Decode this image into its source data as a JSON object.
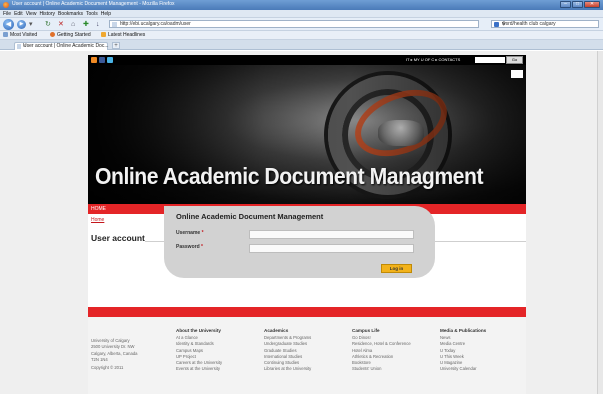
{
  "browser": {
    "window_title": "User account | Online Academic Document Management - Mozilla Firefox",
    "menu": [
      "File",
      "Edit",
      "View",
      "History",
      "Bookmarks",
      "Tools",
      "Help"
    ],
    "url": "http://ebi.ucalgary.ca/oadm/user",
    "search_value": "wsrd/health club calgary",
    "bookmarks": [
      "Most Visited",
      "Getting Started",
      "Latest Headlines"
    ],
    "tab_title": "User account | Online Academic Doc...",
    "new_tab_label": "+",
    "tab_close": "×"
  },
  "site": {
    "top_links": "IT ▸  MY U OF C ▸  CONTACTS",
    "go_label": "Go",
    "banner_title": "Online Academic Document Managment",
    "nav_home": "HOME",
    "breadcrumb": "Home",
    "page_title": "User account"
  },
  "login": {
    "heading": "Online Academic Document Management",
    "username_label": "Username",
    "password_label": "Password",
    "required_mark": "*",
    "submit_label": "Log in"
  },
  "footer": {
    "address": [
      "University of Calgary",
      "2500 University Dr. NW",
      "Calgary, Alberta, Canada",
      "T2N 1N4"
    ],
    "copyright": "Copyright © 2011",
    "columns": [
      {
        "title": "About the University",
        "items": [
          "At a Glance",
          "Identity & Standards",
          "Campus Maps",
          "UP Project",
          "Careers at the University",
          "Events at the University"
        ]
      },
      {
        "title": "Academics",
        "items": [
          "Departments & Programs",
          "Undergraduate Studies",
          "Graduate Studies",
          "International Studies",
          "Continuing Studies",
          "Libraries at the University"
        ]
      },
      {
        "title": "Campus Life",
        "items": [
          "Go Dinos!",
          "Residence, Hotel & Conference",
          "Hotel Alma",
          "Athletics & Recreation",
          "Bookstore",
          "Students' Union"
        ]
      },
      {
        "title": "Media & Publications",
        "items": [
          "News",
          "Media Centre",
          "U Today",
          "U This Week",
          "U Magazine",
          "University Calendar"
        ]
      }
    ]
  },
  "colors": {
    "brand_red": "#e42527",
    "login_button": "#f2b21b",
    "footer_bg": "#f3f3f3"
  }
}
